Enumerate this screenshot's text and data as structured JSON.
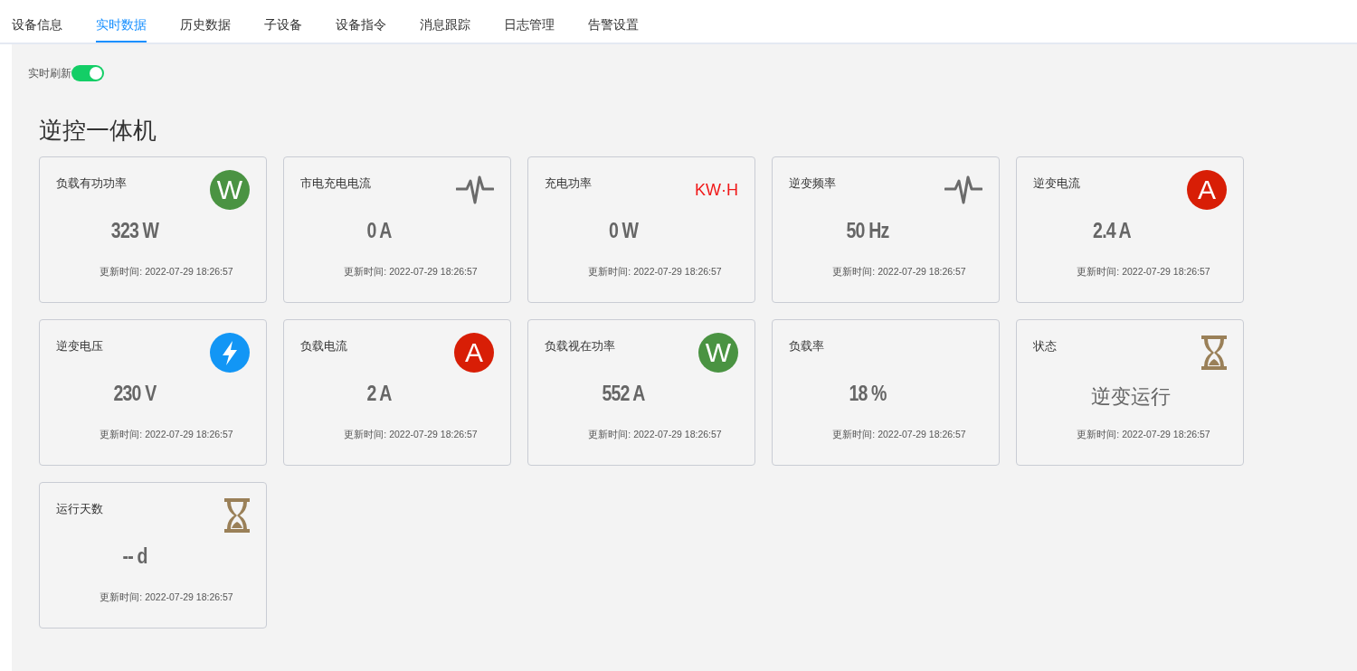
{
  "tabs": [
    {
      "label": "设备信息",
      "selected": false
    },
    {
      "label": "实时数据",
      "selected": true
    },
    {
      "label": "历史数据",
      "selected": false
    },
    {
      "label": "子设备",
      "selected": false
    },
    {
      "label": "设备指令",
      "selected": false
    },
    {
      "label": "消息跟踪",
      "selected": false
    },
    {
      "label": "日志管理",
      "selected": false
    },
    {
      "label": "告警设置",
      "selected": false
    }
  ],
  "refresh": {
    "label": "实时刷新",
    "on": true
  },
  "section_title": "逆控一体机",
  "cards": [
    {
      "kind": "number",
      "label": "负载有功功率",
      "value": "323 W",
      "icon": {
        "kind": "letter",
        "text": "W",
        "color": "#4a9342"
      },
      "updated": "更新时间: 2022-07-29 18:26:57"
    },
    {
      "kind": "number",
      "label": "市电充电电流",
      "value": "0 A",
      "icon": {
        "kind": "wave"
      },
      "updated": "更新时间: 2022-07-29 18:26:57"
    },
    {
      "kind": "number",
      "label": "充电功率",
      "value": "0 W",
      "icon": {
        "kind": "text",
        "text": "KW·H",
        "color": "#f01818"
      },
      "updated": "更新时间: 2022-07-29 18:26:57"
    },
    {
      "kind": "number",
      "label": "逆变频率",
      "value": "50 Hz",
      "icon": {
        "kind": "wave"
      },
      "updated": "更新时间: 2022-07-29 18:26:57"
    },
    {
      "kind": "number",
      "label": "逆变电流",
      "value": "2.4 A",
      "icon": {
        "kind": "letter",
        "text": "A",
        "color": "#d81e06"
      },
      "updated": "更新时间: 2022-07-29 18:26:57"
    },
    {
      "kind": "number",
      "label": "逆变电压",
      "value": "230 V",
      "icon": {
        "kind": "bolt",
        "color": "#1296f5"
      },
      "updated": "更新时间: 2022-07-29 18:26:57"
    },
    {
      "kind": "number",
      "label": "负载电流",
      "value": "2 A",
      "icon": {
        "kind": "letter",
        "text": "A",
        "color": "#d81e06"
      },
      "updated": "更新时间: 2022-07-29 18:26:57"
    },
    {
      "kind": "number",
      "label": "负载视在功率",
      "value": "552 A",
      "icon": {
        "kind": "letter",
        "text": "W",
        "color": "#4a9342"
      },
      "updated": "更新时间: 2022-07-29 18:26:57"
    },
    {
      "kind": "number",
      "label": "负载率",
      "value": "18 %",
      "updated": "更新时间: 2022-07-29 18:26:57"
    },
    {
      "kind": "text",
      "label": "状态",
      "value": "逆变运行",
      "icon": {
        "kind": "hourglass"
      },
      "updated": "更新时间: 2022-07-29 18:26:57"
    },
    {
      "kind": "number",
      "label": "运行天数",
      "value": "-- d",
      "icon": {
        "kind": "hourglass"
      },
      "updated": "更新时间: 2022-07-29 18:26:57"
    }
  ]
}
